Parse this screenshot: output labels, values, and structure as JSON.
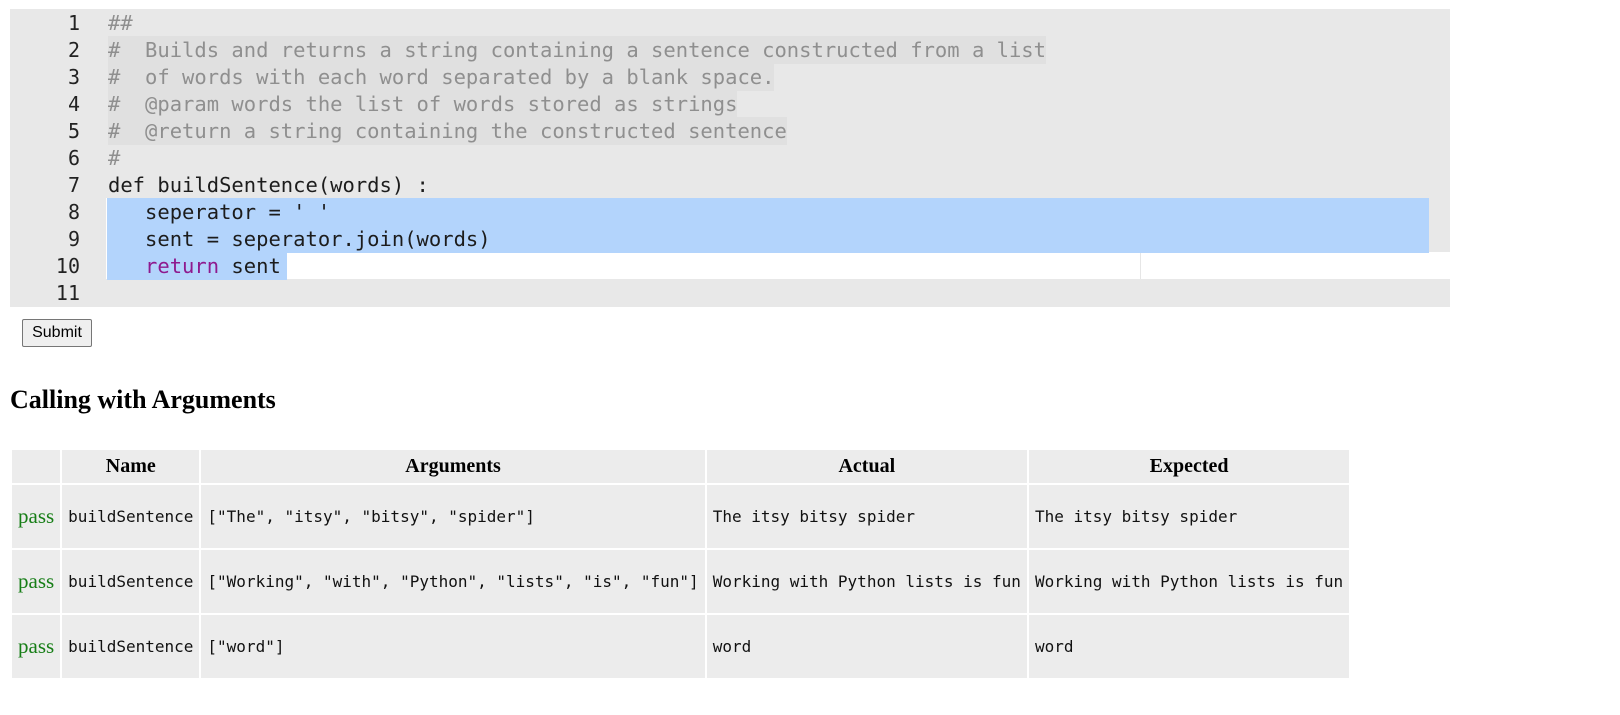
{
  "editor": {
    "lines": [
      {
        "num": "1",
        "text": "##"
      },
      {
        "num": "2",
        "text": "#  Builds and returns a string containing a sentence constructed from a list"
      },
      {
        "num": "3",
        "text": "#  of words with each word separated by a blank space."
      },
      {
        "num": "4",
        "text": "#  @param words the list of words stored as strings"
      },
      {
        "num": "5",
        "text": "#  @return a string containing the constructed sentence"
      },
      {
        "num": "6",
        "text": "#"
      },
      {
        "num": "7",
        "text": "def buildSentence(words) :"
      },
      {
        "num": "8",
        "text": "   seperator = ' '"
      },
      {
        "num": "9",
        "text": "   sent = seperator.join(words)"
      },
      {
        "num": "10",
        "keyword": "return",
        "indent": "   ",
        "rest": " sent"
      },
      {
        "num": "11",
        "text": ""
      }
    ]
  },
  "submit": {
    "label": "Submit"
  },
  "results": {
    "title": "Calling with Arguments",
    "headers": [
      "",
      "Name",
      "Arguments",
      "Actual",
      "Expected"
    ],
    "rows": [
      {
        "status": "pass",
        "name": "buildSentence",
        "arguments": "[\"The\", \"itsy\", \"bitsy\", \"spider\"]",
        "actual": "The itsy bitsy spider",
        "expected": "The itsy bitsy spider"
      },
      {
        "status": "pass",
        "name": "buildSentence",
        "arguments": "[\"Working\", \"with\", \"Python\", \"lists\", \"is\", \"fun\"]",
        "actual": "Working with Python lists is fun",
        "expected": "Working with Python lists is fun"
      },
      {
        "status": "pass",
        "name": "buildSentence",
        "arguments": "[\"word\"]",
        "actual": "word",
        "expected": "word"
      }
    ]
  },
  "colors": {
    "pass": "#177e17",
    "comment": "#8f8f8f",
    "keyword": "#8e1a8e",
    "selection": "#b3d4fc"
  }
}
